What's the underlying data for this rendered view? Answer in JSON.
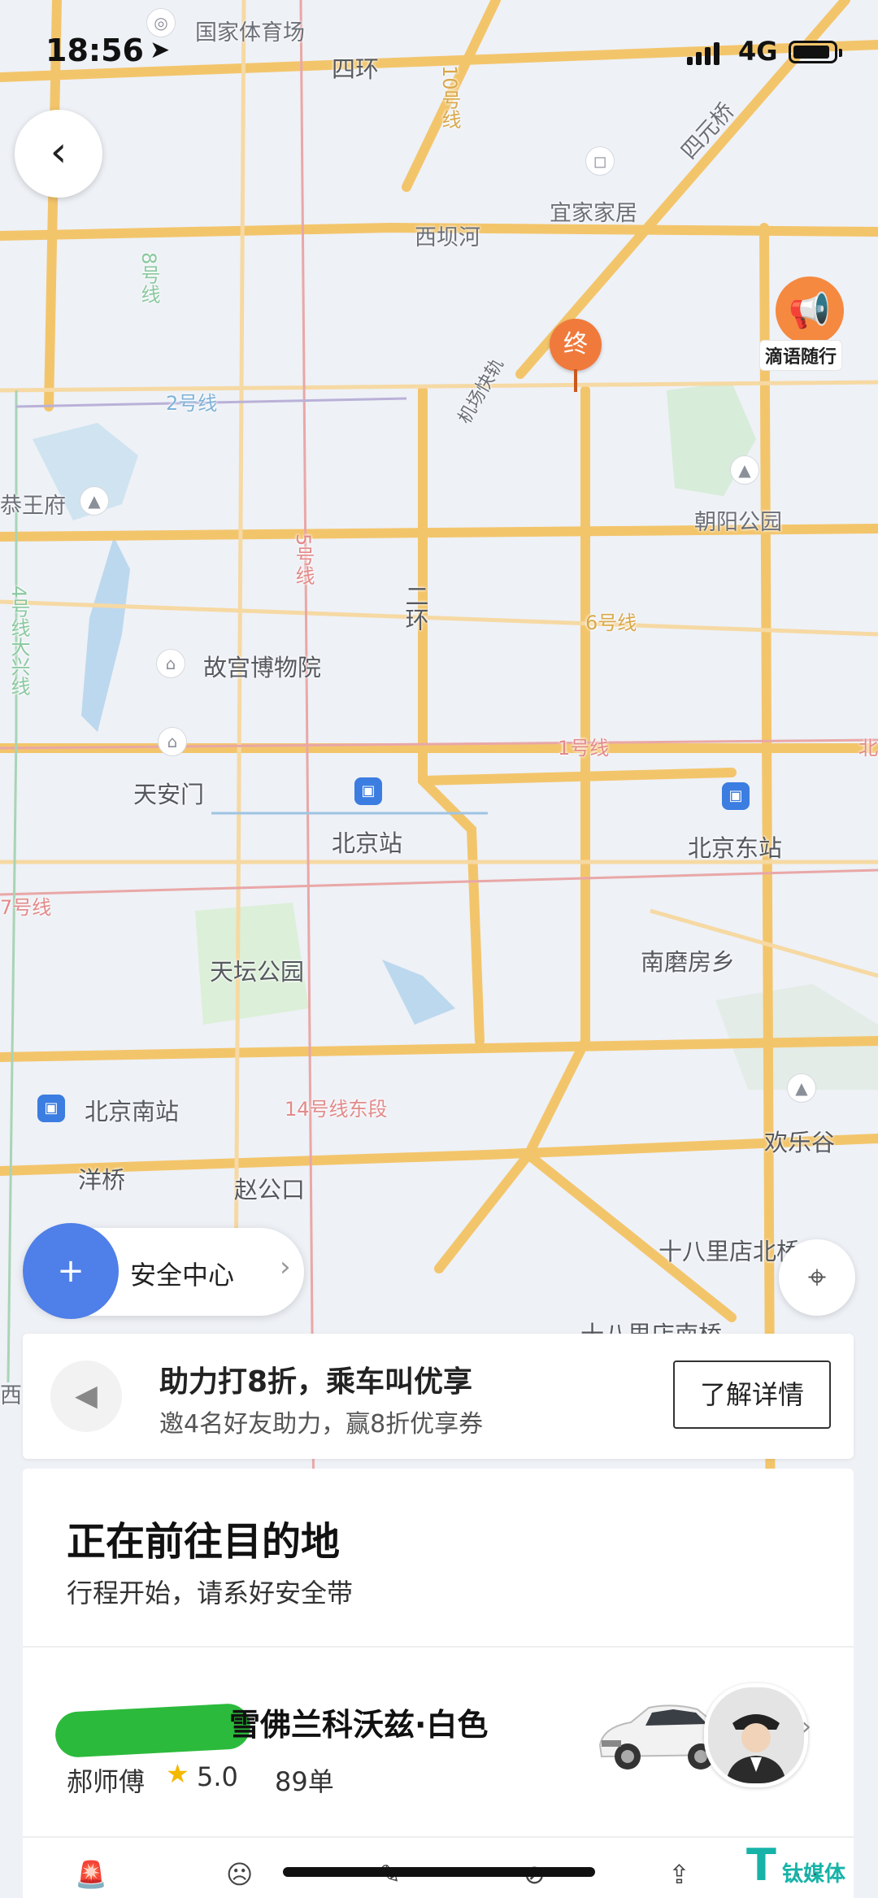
{
  "status_bar": {
    "time": "18:56",
    "location_arrow": "location-arrow-icon",
    "network": "4G"
  },
  "map": {
    "labels": {
      "gym": "国家体育场",
      "ring4": "四环",
      "ikea": "宜家家居",
      "xibahe": "西坝河",
      "siyuanqiao": "四元桥",
      "line8": "8号线",
      "line10": "10号线",
      "line2": "2号线",
      "airport_exp": "机场快轨",
      "gongwangfu": "恭王府",
      "chaoyang_park": "朝阳公园",
      "line5": "5号线",
      "ring2": "二环",
      "line6": "6号线",
      "line4": "4号线大兴线",
      "palace_museum": "故宫博物院",
      "tiananmen": "天安门",
      "line1": "1号线",
      "beijing_station": "北京站",
      "beijing_east": "北京东站",
      "line7": "7号线",
      "temple_of_heaven": "天坛公园",
      "nanmofang": "南磨房乡",
      "beijing_south": "北京南站",
      "line14": "14号线东段",
      "happy_valley": "欢乐谷",
      "yangqiao": "洋桥",
      "zhaogongkou": "赵公口",
      "shibalidian_north": "十八里店北桥",
      "shibalidian_south": "十八里店南桥",
      "xi": "西",
      "east_edge": "北"
    },
    "end_marker": "终",
    "voice_badge_label": "滴语随行"
  },
  "safety": {
    "label": "安全中心",
    "icon": "shield-plus-icon"
  },
  "promo": {
    "title": "助力打8折，乘车叫优享",
    "subtitle": "邀4名好友助力，赢8折优享券",
    "button": "了解详情"
  },
  "trip": {
    "heading": "正在前往目的地",
    "subheading": "行程开始，请系好安全带",
    "car_model": "雪佛兰科沃兹·白色",
    "driver": "郝师傅",
    "rating": "5.0",
    "orders": "89单"
  },
  "colors": {
    "road": "#f3c56b",
    "accent_orange": "#f07a3c",
    "safety_blue": "#4f7fe8",
    "plate_mask": "#2cba3c",
    "watermark": "#17b3a8"
  },
  "watermark": {
    "letter": "T",
    "text": "钛媒体"
  }
}
